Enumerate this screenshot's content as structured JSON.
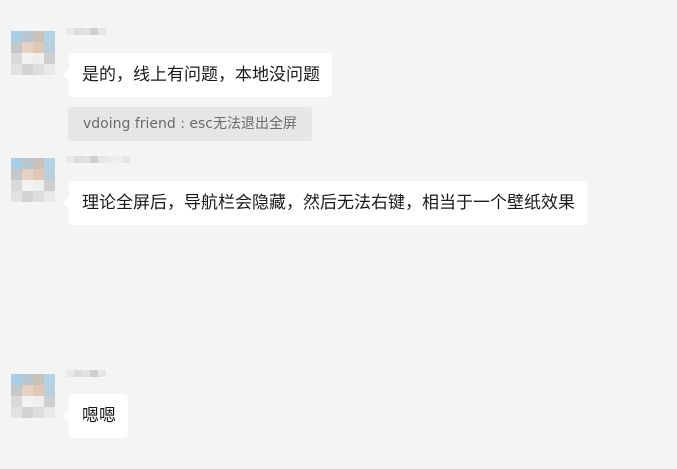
{
  "colors": {
    "background": "#f4f4f4",
    "bubble": "#ffffff",
    "quote_bg": "#e6e6e6",
    "quote_text": "#6b6b6b",
    "text": "#1a1a1a"
  },
  "messages": [
    {
      "text": "是的，线上有问题，本地没问题",
      "quote": "vdoing friend : esc无法退出全屏"
    },
    {
      "text": "理论全屏后，导航栏会隐藏，然后无法右键，相当于一个壁纸效果"
    },
    {
      "text": "嗯嗯"
    }
  ]
}
